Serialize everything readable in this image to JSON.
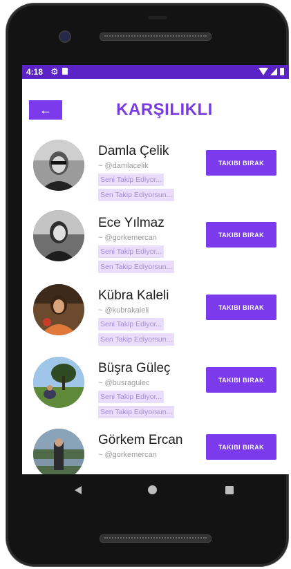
{
  "status_bar": {
    "time": "4:18"
  },
  "header": {
    "back_icon": "arrow-left-icon",
    "title": "KARŞILIKLI"
  },
  "colors": {
    "accent": "#7c3aed",
    "status_bar": "#5b22c6",
    "title": "#7a3be3",
    "badge_bg": "#e9ddfb"
  },
  "users": [
    {
      "name": "Damla Çelik",
      "handle": "~ @damlacelik",
      "follows_you": "Seni Takip Ediyor...",
      "you_follow": "Sen Takip Ediyorsun...",
      "button": "TAKIBI BIRAK"
    },
    {
      "name": "Ece Yılmaz",
      "handle": "~ @gorkemercan",
      "follows_you": "Seni Takip Ediyor...",
      "you_follow": "Sen Takip Ediyorsun...",
      "button": "TAKIBI BIRAK"
    },
    {
      "name": "Kübra Kaleli",
      "handle": "~ @kubrakaleli",
      "follows_you": "Seni Takip Ediyor...",
      "you_follow": "Sen Takip Ediyorsun...",
      "button": "TAKIBI BIRAK"
    },
    {
      "name": "Büşra Güleç",
      "handle": "~ @busragulec",
      "follows_you": "Seni Takip Ediyor...",
      "you_follow": "Sen Takip Ediyorsun...",
      "button": "TAKIBI BIRAK"
    },
    {
      "name": "Görkem Ercan",
      "handle": "~ @gorkemercan",
      "button": "TAKIBI BIRAK"
    }
  ]
}
